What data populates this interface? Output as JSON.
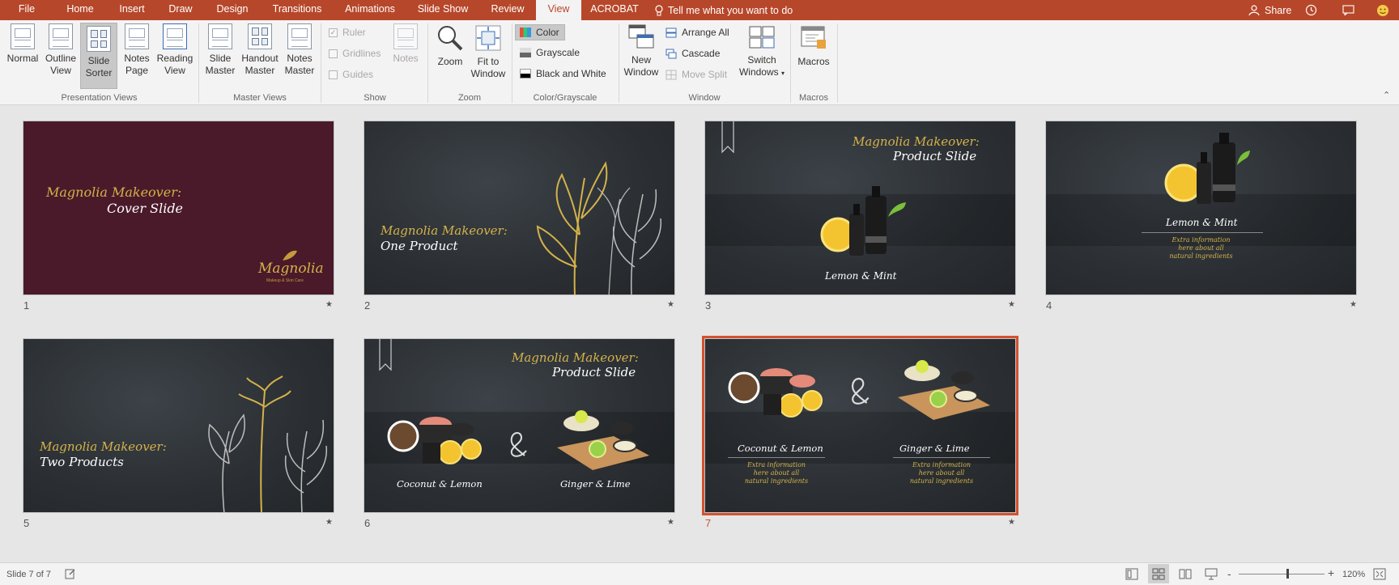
{
  "tabs": [
    "File",
    "Home",
    "Insert",
    "Draw",
    "Design",
    "Transitions",
    "Animations",
    "Slide Show",
    "Review",
    "View",
    "ACROBAT"
  ],
  "tell_me": "Tell me what you want to do",
  "share": "Share",
  "ribbon": {
    "presentation_views": {
      "normal": [
        "Normal",
        ""
      ],
      "outline": [
        "Outline",
        "View"
      ],
      "sorter": [
        "Slide",
        "Sorter"
      ],
      "notes": [
        "Notes",
        "Page"
      ],
      "reading": [
        "Reading",
        "View"
      ],
      "group": "Presentation Views"
    },
    "master_views": {
      "slide": [
        "Slide",
        "Master"
      ],
      "handout": [
        "Handout",
        "Master"
      ],
      "notes": [
        "Notes",
        "Master"
      ],
      "group": "Master Views"
    },
    "show": {
      "ruler": "Ruler",
      "gridlines": "Gridlines",
      "guides": "Guides",
      "notes": "Notes",
      "group": "Show"
    },
    "zoom": {
      "zoom": "Zoom",
      "fit": [
        "Fit to",
        "Window"
      ],
      "group": "Zoom"
    },
    "color": {
      "color": "Color",
      "grayscale": "Grayscale",
      "bw": "Black and White",
      "group": "Color/Grayscale"
    },
    "window": {
      "new": [
        "New",
        "Window"
      ],
      "arrange": "Arrange All",
      "cascade": "Cascade",
      "move_split": "Move Split",
      "switch": [
        "Switch",
        "Windows"
      ],
      "group": "Window"
    },
    "macros": {
      "label": "Macros",
      "group": "Macros"
    }
  },
  "slides": [
    {
      "num": "1",
      "title_a": "Magnolia Makeover:",
      "title_b": "Cover Slide",
      "logo": "Magnolia",
      "logo_sub": "Makeup & Skin Care"
    },
    {
      "num": "2",
      "title_a": "Magnolia Makeover:",
      "title_b": "One Product"
    },
    {
      "num": "3",
      "title_a": "Magnolia Makeover:",
      "title_b": "Product Slide",
      "caption": "Lemon & Mint"
    },
    {
      "num": "4",
      "caption": "Lemon & Mint",
      "info": [
        "Extra information",
        "here about all",
        "natural ingredients"
      ]
    },
    {
      "num": "5",
      "title_a": "Magnolia Makeover:",
      "title_b": "Two Products"
    },
    {
      "num": "6",
      "title_a": "Magnolia Makeover:",
      "title_b": "Product Slide",
      "caption_a": "Coconut & Lemon",
      "caption_b": "Ginger & Lime"
    },
    {
      "num": "7",
      "caption_a": "Coconut & Lemon",
      "caption_b": "Ginger & Lime",
      "info": [
        "Extra information",
        "here about all",
        "natural ingredients"
      ]
    }
  ],
  "status": {
    "slide_counter": "Slide 7 of 7",
    "zoom_level": "120%",
    "minus": "-",
    "plus": "+"
  },
  "colors": {
    "accent": "#b7472a",
    "selected_outline": "#d35230",
    "gold": "#d4b24a",
    "cover_bg": "#4a1a2a",
    "slide_dark": "#2b2f33"
  }
}
